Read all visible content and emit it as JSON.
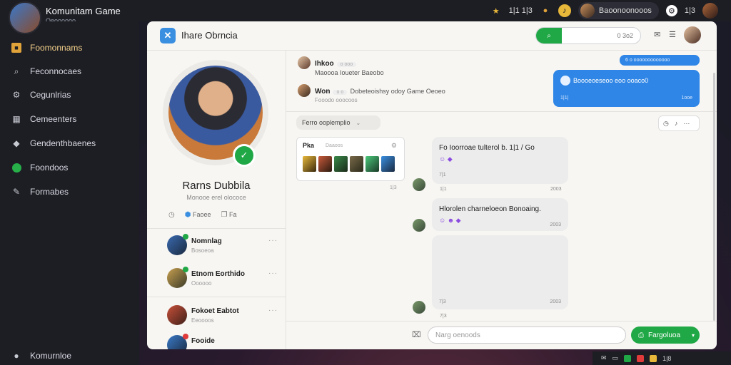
{
  "app": {
    "title": "Komunitam Game",
    "subtitle": "Oeoooooo"
  },
  "topbar": {
    "stat_value": "1|1 1|3",
    "user_name": "Baoonoonooos",
    "badge": "1|3",
    "icons": [
      "trophy-icon",
      "coin-icon",
      "bell-icon"
    ]
  },
  "sidebar": {
    "items": [
      {
        "label": "Foomonnams",
        "icon": "home-icon",
        "active": true
      },
      {
        "label": "Feconnocaes",
        "icon": "search-icon"
      },
      {
        "label": "Cegunlrias",
        "icon": "gear-icon"
      },
      {
        "label": "Cemeenters",
        "icon": "calendar-icon"
      },
      {
        "label": "Gendenthbaenes",
        "icon": "tag-icon"
      },
      {
        "label": "Foondoos",
        "icon": "online-dot-icon"
      },
      {
        "label": "Formabes",
        "icon": "wrench-icon"
      }
    ],
    "footer": "Komurnloe"
  },
  "window": {
    "title": "Ihare Obrncia",
    "search_value": "0 3o2",
    "accent": "#21a846",
    "blue": "#2f86e6"
  },
  "profile": {
    "name": "Rarns Dubbila",
    "subtitle": "Monooe erel olococe",
    "actions": [
      "Faoee",
      "Fa"
    ],
    "contacts": [
      {
        "name": "Nomnlag",
        "sub": "Bosoeoa",
        "badge": "#21a846"
      },
      {
        "name": "Etnom Eorthido",
        "sub": "Oooooo",
        "badge": "#21a846"
      },
      {
        "name": "Fokoet Eabtot",
        "sub": "Eeoooos",
        "badge": ""
      },
      {
        "name": "Fooide",
        "sub": "",
        "badge": "#e03a3a"
      }
    ]
  },
  "chat": {
    "head_messages": [
      {
        "name": "Ihkoo",
        "tag": "o ooo",
        "text": "Maoooa Ioueter Baeobo"
      },
      {
        "name": "Won",
        "tag": "o o",
        "text": "Dobeteoishsy odoy Game Oeoeo",
        "sub": "Fooodo ooocoos"
      }
    ],
    "blue_tag": "6 o ooooooooooooo",
    "blue_bubble": {
      "text": "Boooeoeseoo eoo ooaco0",
      "time_left": "1|1|",
      "time_right": "1ooe"
    },
    "filter": "Ferro ooplemplio",
    "card": {
      "name": "Pka",
      "tag": "Daaoos"
    },
    "card_time": "1|3",
    "bubbles": [
      {
        "text": "Fo Ioorroae tulterol b. 1|1 / Go",
        "sub": "7|1",
        "time_left": "1|1",
        "time_right": "2003"
      },
      {
        "text": "Hlorolen charneloeon Bonoaing.",
        "time_left": "",
        "time_right": "2003"
      },
      {
        "text": "",
        "time_left": "7|3",
        "time_right": "2003"
      }
    ],
    "tail_time": "7|3",
    "composer_placeholder": "Narg oenoods",
    "send_label": "Fargoluoa"
  },
  "tray": {
    "value": "1|8"
  }
}
